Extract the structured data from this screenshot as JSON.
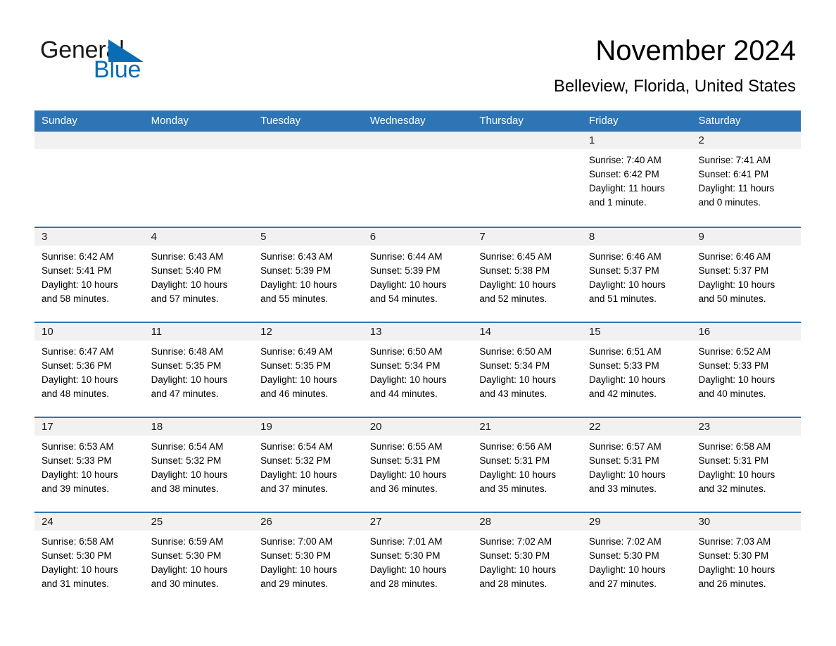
{
  "logo": {
    "word1": "General",
    "word2": "Blue",
    "triangle_color": "#0b6cb6",
    "text_color": "#1a1a1a"
  },
  "header": {
    "title": "November 2024",
    "location": "Belleview, Florida, United States"
  },
  "theme": {
    "header_blue": "#2e75b6",
    "row_separator": "#2e75b6",
    "day_strip_gray": "#f1f1f1",
    "page_background": "#ffffff"
  },
  "weekdays": [
    "Sunday",
    "Monday",
    "Tuesday",
    "Wednesday",
    "Thursday",
    "Friday",
    "Saturday"
  ],
  "labels": {
    "sunrise_prefix": "Sunrise:",
    "sunset_prefix": "Sunset:",
    "daylight_prefix": "Daylight:"
  },
  "weeks": [
    [
      {
        "empty": true
      },
      {
        "empty": true
      },
      {
        "empty": true
      },
      {
        "empty": true
      },
      {
        "empty": true
      },
      {
        "day": "1",
        "sunrise": "Sunrise: 7:40 AM",
        "sunset": "Sunset: 6:42 PM",
        "daylight_l1": "Daylight: 11 hours",
        "daylight_l2": "and 1 minute."
      },
      {
        "day": "2",
        "sunrise": "Sunrise: 7:41 AM",
        "sunset": "Sunset: 6:41 PM",
        "daylight_l1": "Daylight: 11 hours",
        "daylight_l2": "and 0 minutes."
      }
    ],
    [
      {
        "day": "3",
        "sunrise": "Sunrise: 6:42 AM",
        "sunset": "Sunset: 5:41 PM",
        "daylight_l1": "Daylight: 10 hours",
        "daylight_l2": "and 58 minutes."
      },
      {
        "day": "4",
        "sunrise": "Sunrise: 6:43 AM",
        "sunset": "Sunset: 5:40 PM",
        "daylight_l1": "Daylight: 10 hours",
        "daylight_l2": "and 57 minutes."
      },
      {
        "day": "5",
        "sunrise": "Sunrise: 6:43 AM",
        "sunset": "Sunset: 5:39 PM",
        "daylight_l1": "Daylight: 10 hours",
        "daylight_l2": "and 55 minutes."
      },
      {
        "day": "6",
        "sunrise": "Sunrise: 6:44 AM",
        "sunset": "Sunset: 5:39 PM",
        "daylight_l1": "Daylight: 10 hours",
        "daylight_l2": "and 54 minutes."
      },
      {
        "day": "7",
        "sunrise": "Sunrise: 6:45 AM",
        "sunset": "Sunset: 5:38 PM",
        "daylight_l1": "Daylight: 10 hours",
        "daylight_l2": "and 52 minutes."
      },
      {
        "day": "8",
        "sunrise": "Sunrise: 6:46 AM",
        "sunset": "Sunset: 5:37 PM",
        "daylight_l1": "Daylight: 10 hours",
        "daylight_l2": "and 51 minutes."
      },
      {
        "day": "9",
        "sunrise": "Sunrise: 6:46 AM",
        "sunset": "Sunset: 5:37 PM",
        "daylight_l1": "Daylight: 10 hours",
        "daylight_l2": "and 50 minutes."
      }
    ],
    [
      {
        "day": "10",
        "sunrise": "Sunrise: 6:47 AM",
        "sunset": "Sunset: 5:36 PM",
        "daylight_l1": "Daylight: 10 hours",
        "daylight_l2": "and 48 minutes."
      },
      {
        "day": "11",
        "sunrise": "Sunrise: 6:48 AM",
        "sunset": "Sunset: 5:35 PM",
        "daylight_l1": "Daylight: 10 hours",
        "daylight_l2": "and 47 minutes."
      },
      {
        "day": "12",
        "sunrise": "Sunrise: 6:49 AM",
        "sunset": "Sunset: 5:35 PM",
        "daylight_l1": "Daylight: 10 hours",
        "daylight_l2": "and 46 minutes."
      },
      {
        "day": "13",
        "sunrise": "Sunrise: 6:50 AM",
        "sunset": "Sunset: 5:34 PM",
        "daylight_l1": "Daylight: 10 hours",
        "daylight_l2": "and 44 minutes."
      },
      {
        "day": "14",
        "sunrise": "Sunrise: 6:50 AM",
        "sunset": "Sunset: 5:34 PM",
        "daylight_l1": "Daylight: 10 hours",
        "daylight_l2": "and 43 minutes."
      },
      {
        "day": "15",
        "sunrise": "Sunrise: 6:51 AM",
        "sunset": "Sunset: 5:33 PM",
        "daylight_l1": "Daylight: 10 hours",
        "daylight_l2": "and 42 minutes."
      },
      {
        "day": "16",
        "sunrise": "Sunrise: 6:52 AM",
        "sunset": "Sunset: 5:33 PM",
        "daylight_l1": "Daylight: 10 hours",
        "daylight_l2": "and 40 minutes."
      }
    ],
    [
      {
        "day": "17",
        "sunrise": "Sunrise: 6:53 AM",
        "sunset": "Sunset: 5:33 PM",
        "daylight_l1": "Daylight: 10 hours",
        "daylight_l2": "and 39 minutes."
      },
      {
        "day": "18",
        "sunrise": "Sunrise: 6:54 AM",
        "sunset": "Sunset: 5:32 PM",
        "daylight_l1": "Daylight: 10 hours",
        "daylight_l2": "and 38 minutes."
      },
      {
        "day": "19",
        "sunrise": "Sunrise: 6:54 AM",
        "sunset": "Sunset: 5:32 PM",
        "daylight_l1": "Daylight: 10 hours",
        "daylight_l2": "and 37 minutes."
      },
      {
        "day": "20",
        "sunrise": "Sunrise: 6:55 AM",
        "sunset": "Sunset: 5:31 PM",
        "daylight_l1": "Daylight: 10 hours",
        "daylight_l2": "and 36 minutes."
      },
      {
        "day": "21",
        "sunrise": "Sunrise: 6:56 AM",
        "sunset": "Sunset: 5:31 PM",
        "daylight_l1": "Daylight: 10 hours",
        "daylight_l2": "and 35 minutes."
      },
      {
        "day": "22",
        "sunrise": "Sunrise: 6:57 AM",
        "sunset": "Sunset: 5:31 PM",
        "daylight_l1": "Daylight: 10 hours",
        "daylight_l2": "and 33 minutes."
      },
      {
        "day": "23",
        "sunrise": "Sunrise: 6:58 AM",
        "sunset": "Sunset: 5:31 PM",
        "daylight_l1": "Daylight: 10 hours",
        "daylight_l2": "and 32 minutes."
      }
    ],
    [
      {
        "day": "24",
        "sunrise": "Sunrise: 6:58 AM",
        "sunset": "Sunset: 5:30 PM",
        "daylight_l1": "Daylight: 10 hours",
        "daylight_l2": "and 31 minutes."
      },
      {
        "day": "25",
        "sunrise": "Sunrise: 6:59 AM",
        "sunset": "Sunset: 5:30 PM",
        "daylight_l1": "Daylight: 10 hours",
        "daylight_l2": "and 30 minutes."
      },
      {
        "day": "26",
        "sunrise": "Sunrise: 7:00 AM",
        "sunset": "Sunset: 5:30 PM",
        "daylight_l1": "Daylight: 10 hours",
        "daylight_l2": "and 29 minutes."
      },
      {
        "day": "27",
        "sunrise": "Sunrise: 7:01 AM",
        "sunset": "Sunset: 5:30 PM",
        "daylight_l1": "Daylight: 10 hours",
        "daylight_l2": "and 28 minutes."
      },
      {
        "day": "28",
        "sunrise": "Sunrise: 7:02 AM",
        "sunset": "Sunset: 5:30 PM",
        "daylight_l1": "Daylight: 10 hours",
        "daylight_l2": "and 28 minutes."
      },
      {
        "day": "29",
        "sunrise": "Sunrise: 7:02 AM",
        "sunset": "Sunset: 5:30 PM",
        "daylight_l1": "Daylight: 10 hours",
        "daylight_l2": "and 27 minutes."
      },
      {
        "day": "30",
        "sunrise": "Sunrise: 7:03 AM",
        "sunset": "Sunset: 5:30 PM",
        "daylight_l1": "Daylight: 10 hours",
        "daylight_l2": "and 26 minutes."
      }
    ]
  ]
}
